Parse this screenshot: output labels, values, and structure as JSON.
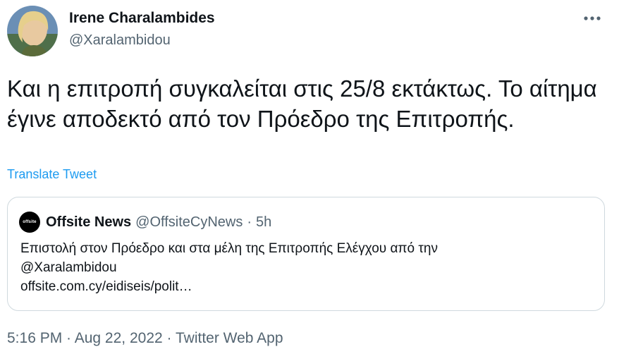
{
  "author": {
    "name": "Irene Charalambides",
    "handle": "@Xaralambidou"
  },
  "tweet": {
    "text": "Και η επιτροπή συγκαλείται στις 25/8 εκτάκτως. Το αίτημα έγινε αποδεκτό από τον Πρόεδρο της Επιτροπής.",
    "translate_label": "Translate Tweet"
  },
  "quote": {
    "logo_text": "offsite",
    "name": "Offsite News",
    "handle": "@OffsiteCyNews",
    "separator": "·",
    "time": "5h",
    "text_line1": "Επιστολή στον Πρόεδρο και στα μέλη της Επιτροπής Ελέγχου από την",
    "text_line2": "@Xaralambidou",
    "link": "offsite.com.cy/eidiseis/polit…"
  },
  "meta": {
    "time": "5:16 PM",
    "sep1": " · ",
    "date": "Aug 22, 2022",
    "sep2": " · ",
    "source": "Twitter Web App"
  },
  "icons": {
    "more": "more-dots-icon",
    "avatar": "profile-photo"
  },
  "colors": {
    "link": "#1d9bf0",
    "secondary": "#536471",
    "border": "#cfd9de"
  }
}
